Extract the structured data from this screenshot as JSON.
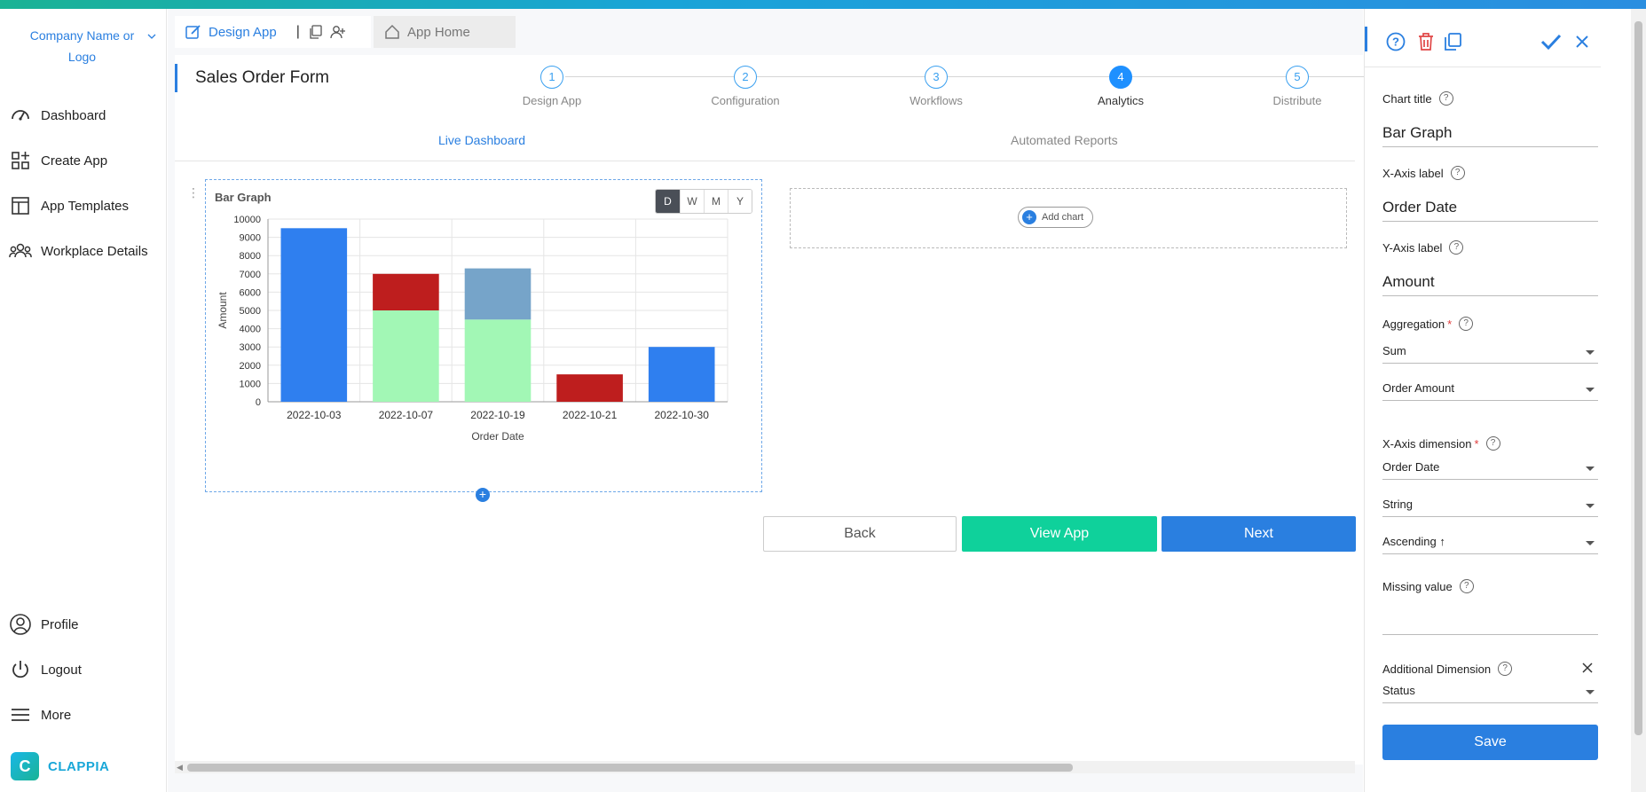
{
  "sidebar": {
    "company": "Company Name or Logo",
    "items": [
      {
        "label": "Dashboard",
        "icon": "speedometer-icon"
      },
      {
        "label": "Create App",
        "icon": "grid-plus-icon"
      },
      {
        "label": "App Templates",
        "icon": "template-icon"
      },
      {
        "label": "Workplace Details",
        "icon": "people-icon"
      }
    ],
    "bottom_items": [
      {
        "label": "Profile",
        "icon": "user-circle-icon"
      },
      {
        "label": "Logout",
        "icon": "power-icon"
      },
      {
        "label": "More",
        "icon": "menu-icon"
      }
    ],
    "brand": "CLAPPIA"
  },
  "tabs": {
    "active": "Design App",
    "inactive": "App Home"
  },
  "form_title": "Sales Order Form",
  "stepper": [
    {
      "num": "1",
      "label": "Design App"
    },
    {
      "num": "2",
      "label": "Configuration"
    },
    {
      "num": "3",
      "label": "Workflows"
    },
    {
      "num": "4",
      "label": "Analytics",
      "active": true
    },
    {
      "num": "5",
      "label": "Distribute"
    }
  ],
  "subtabs": {
    "live": "Live Dashboard",
    "reports": "Automated Reports"
  },
  "chart_card": {
    "title": "Bar Graph",
    "period_buttons": [
      "D",
      "W",
      "M",
      "Y"
    ]
  },
  "chart_data": {
    "type": "bar",
    "stacked": true,
    "title": "Bar Graph",
    "xlabel": "Order Date",
    "ylabel": "Amount",
    "ylim": [
      0,
      10000
    ],
    "yticks": [
      0,
      1000,
      2000,
      3000,
      4000,
      5000,
      6000,
      7000,
      8000,
      9000,
      10000
    ],
    "categories": [
      "2022-10-03",
      "2022-10-07",
      "2022-10-19",
      "2022-10-21",
      "2022-10-30"
    ],
    "series": [
      {
        "color": "#2f7fef",
        "values": [
          9500,
          0,
          0,
          0,
          3000
        ]
      },
      {
        "color": "#a2f7b5",
        "values": [
          0,
          5000,
          4500,
          0,
          0
        ]
      },
      {
        "color": "#be1e1e",
        "values": [
          0,
          2000,
          0,
          1500,
          0
        ]
      },
      {
        "color": "#76a4c9",
        "values": [
          0,
          0,
          2800,
          0,
          0
        ]
      }
    ],
    "grid": true,
    "legend": "none"
  },
  "add_chart": "Add chart",
  "buttons": {
    "back": "Back",
    "view": "View App",
    "next": "Next"
  },
  "panel": {
    "chart_title_label": "Chart title",
    "chart_title_value": "Bar Graph",
    "xaxis_label_label": "X-Axis label",
    "xaxis_label_value": "Order Date",
    "yaxis_label_label": "Y-Axis label",
    "yaxis_label_value": "Amount",
    "aggregation_label": "Aggregation",
    "aggregation_value": "Sum",
    "aggregation_field": "Order Amount",
    "xdim_label": "X-Axis dimension",
    "xdim_value": "Order Date",
    "xdim_type": "String",
    "xdim_sort": "Ascending ↑",
    "missing_label": "Missing value",
    "missing_value": "",
    "additional_label": "Additional Dimension",
    "additional_value": "Status",
    "save": "Save"
  },
  "colors": {
    "accent": "#2a7fe0",
    "green": "#0fd19b"
  }
}
